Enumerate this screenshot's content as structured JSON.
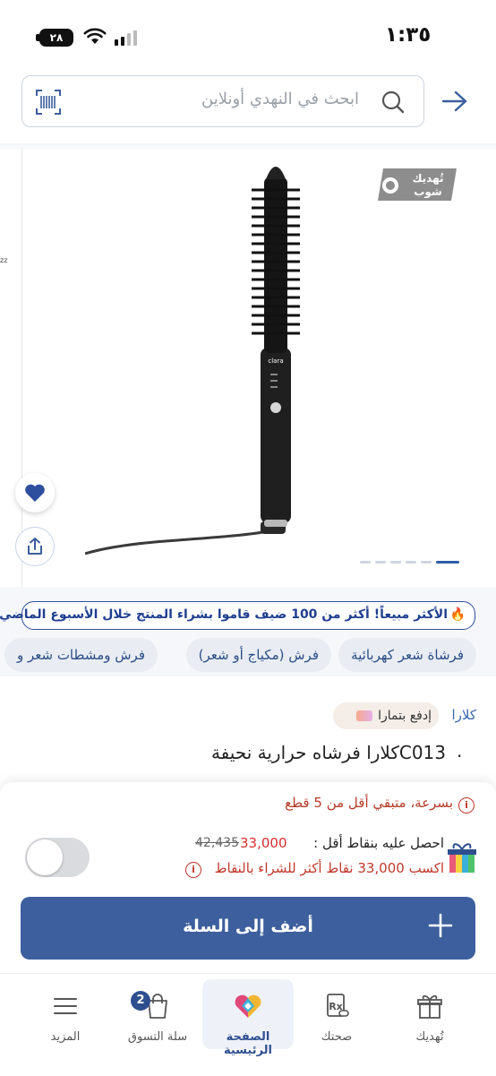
{
  "status_bar": {
    "time": "١:٣٥",
    "battery": "٢٨"
  },
  "search": {
    "placeholder": "ابحث في النهدي أونلاين"
  },
  "product": {
    "side_text": "zz",
    "image_logo_text": "تُهديك شوب",
    "image_dots_count": 6,
    "best_seller": "الأكثر مبيعاً! أكثر من 100 ضيف قاموا بشراء  المنتج خلال الأسبوع الماضي",
    "chips": [
      "فرشاة شعر كهربائية",
      "فرش (مكياج أو شعر)",
      "فرش ومشطات شعر و"
    ],
    "brand": "كلارا",
    "tamara": "إدفع بتمارا",
    "title": "C013كلارا فرشاه حرارية نحيفة",
    "title_dot": "."
  },
  "sheet": {
    "stock_warning": "بسرعة، متبقي أقل من 5 قطع",
    "points_label": "احصل عليه بنقاط أقل :",
    "points_value": "33,000",
    "points_old": "42,435",
    "points_earn": "اكسب 33,000 نقاط أكثر للشراء بالنقاط",
    "add_to_cart": "أضف إلى السلة"
  },
  "nav": {
    "gift": "تُهديك",
    "health": "صحتك",
    "home": "الصفحة الرئيسية",
    "cart": "سلة التسوق",
    "cart_count": "2",
    "more": "المزيد"
  },
  "colors": {
    "primary": "#3d5f9d",
    "accent_red": "#d62d2d",
    "brand_blue": "#1f3f8f"
  }
}
